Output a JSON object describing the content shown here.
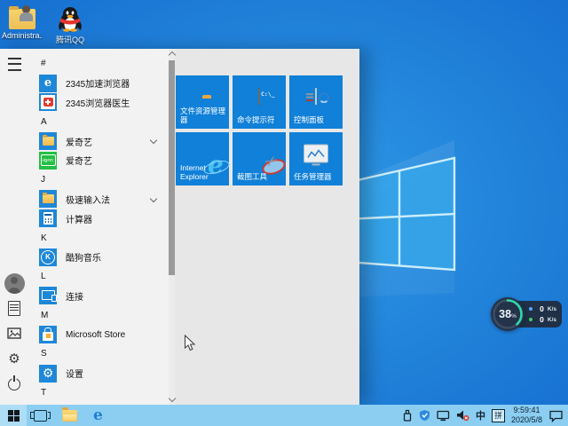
{
  "desktop": {
    "icons": [
      {
        "key": "administrator",
        "label": "Administra...",
        "icon": "admin-folder"
      },
      {
        "key": "tencent-qq",
        "label": "腾讯QQ",
        "icon": "qq"
      }
    ]
  },
  "start_menu": {
    "app_list": {
      "sections": [
        {
          "header": "#",
          "items": [
            {
              "key": "2345-browser",
              "name": "2345加速浏览器",
              "icon": "browser-2345",
              "expandable": false
            },
            {
              "key": "2345-doctor",
              "name": "2345浏览器医生",
              "icon": "doctor-2345",
              "expandable": false
            }
          ]
        },
        {
          "header": "A",
          "items": [
            {
              "key": "iqiyi-folder",
              "name": "爱奇艺",
              "icon": "app-folder",
              "expandable": true
            },
            {
              "key": "iqiyi",
              "name": "爱奇艺",
              "icon": "iqiyi",
              "expandable": false
            }
          ]
        },
        {
          "header": "J",
          "items": [
            {
              "key": "jisu-ime-folder",
              "name": "极速输入法",
              "icon": "app-folder",
              "expandable": true
            },
            {
              "key": "calculator",
              "name": "计算器",
              "icon": "calculator",
              "expandable": false
            }
          ]
        },
        {
          "header": "K",
          "items": [
            {
              "key": "kugou-music",
              "name": "酷狗音乐",
              "icon": "kugou",
              "expandable": false
            }
          ]
        },
        {
          "header": "L",
          "items": [
            {
              "key": "connect",
              "name": "连接",
              "icon": "connect",
              "expandable": false
            }
          ]
        },
        {
          "header": "M",
          "items": [
            {
              "key": "microsoft-store",
              "name": "Microsoft Store",
              "icon": "store",
              "expandable": false
            }
          ]
        },
        {
          "header": "S",
          "items": [
            {
              "key": "settings",
              "name": "设置",
              "icon": "settings",
              "expandable": false
            }
          ]
        },
        {
          "header": "T",
          "items": []
        }
      ]
    },
    "tiles": [
      {
        "key": "file-explorer",
        "label": "文件资源管理器",
        "icon": "explorer"
      },
      {
        "key": "cmd",
        "label": "命令提示符",
        "icon": "cmd"
      },
      {
        "key": "control-panel",
        "label": "控制面板",
        "icon": "control-panel"
      },
      {
        "key": "internet-explorer",
        "label": "Internet Explorer",
        "icon": "ie"
      },
      {
        "key": "snipping-tool",
        "label": "截图工具",
        "icon": "snipping"
      },
      {
        "key": "task-manager",
        "label": "任务管理器",
        "icon": "task-manager"
      }
    ]
  },
  "taskbar": {
    "ime_mode": "中",
    "ime_shape": "拼",
    "clock": {
      "time": "9:59:41",
      "date": "2020/5/8"
    }
  },
  "widget": {
    "percent": "38",
    "percent_unit": "%",
    "upload": {
      "value": "0",
      "unit": "K/s"
    },
    "download": {
      "value": "0",
      "unit": "K/s"
    }
  },
  "colors": {
    "tile_blue": "#1080d8",
    "taskbar_blue": "#8bcef2",
    "ring_teal": "#2fd8ab",
    "upload_dot": "#57a8ff",
    "download_dot": "#3fd06b"
  }
}
